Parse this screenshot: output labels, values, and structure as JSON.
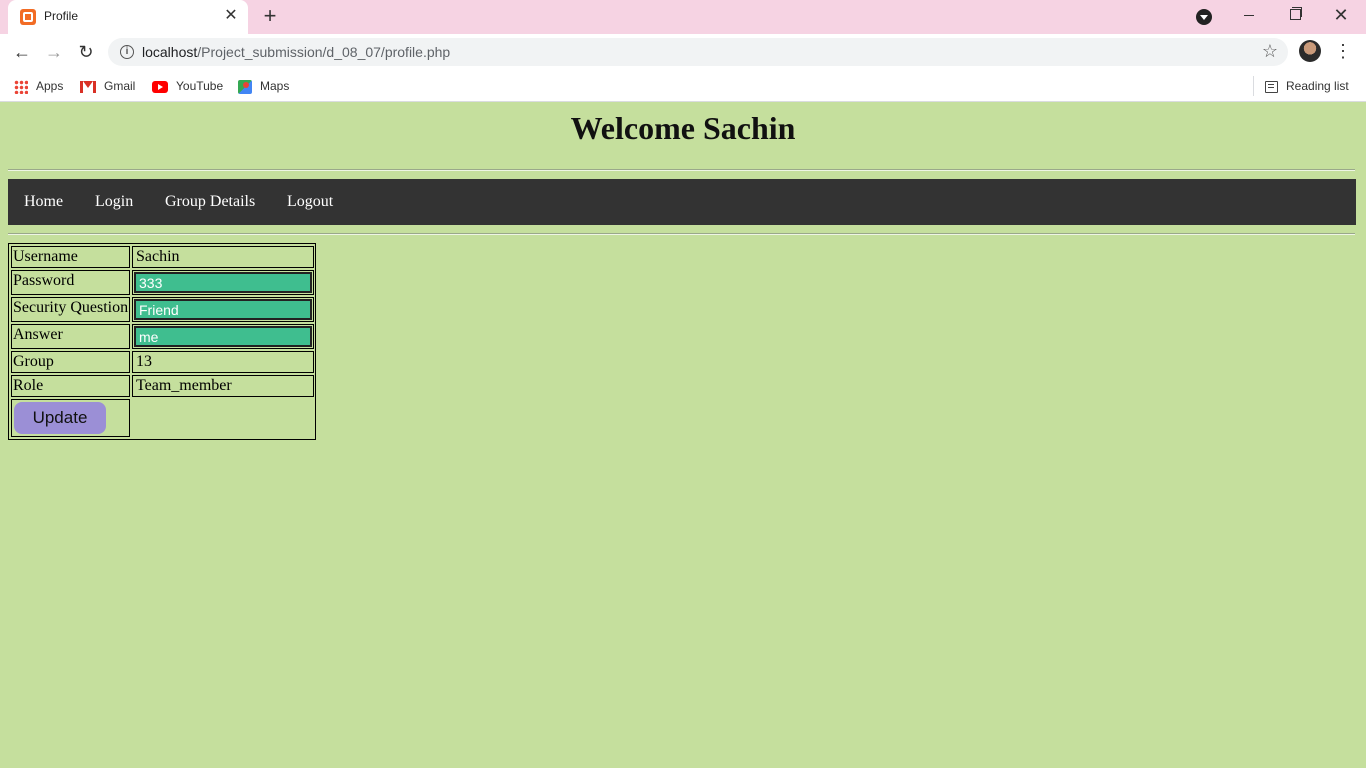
{
  "browser": {
    "tab_title": "Profile",
    "tab_close": "✕",
    "new_tab": "+",
    "url_host": "localhost",
    "url_path": "/Project_submission/d_08_07/profile.php",
    "bookmarks": [
      {
        "label": "Apps",
        "icon": "apps-icon"
      },
      {
        "label": "Gmail",
        "icon": "gmail-icon"
      },
      {
        "label": "YouTube",
        "icon": "youtube-icon"
      },
      {
        "label": "Maps",
        "icon": "maps-icon"
      }
    ],
    "reading_list": "Reading list"
  },
  "page": {
    "heading": "Welcome Sachin",
    "nav": {
      "home": "Home",
      "login": "Login",
      "group_details": "Group Details",
      "logout": "Logout"
    },
    "profile": {
      "username_label": "Username",
      "username_value": "Sachin",
      "password_label": "Password",
      "password_value": "333",
      "security_question_label": "Security Question",
      "security_question_value": "Friend",
      "answer_label": "Answer",
      "answer_value": "me",
      "group_label": "Group",
      "group_value": "13",
      "role_label": "Role",
      "role_value": "Team_member",
      "update_button": "Update"
    }
  },
  "colors": {
    "page_background": "#c5df9d",
    "navbar": "#333333",
    "input_fill": "#3fbe8f",
    "update_button": "#9b8fd6",
    "tab_strip": "#f6d3e3"
  }
}
